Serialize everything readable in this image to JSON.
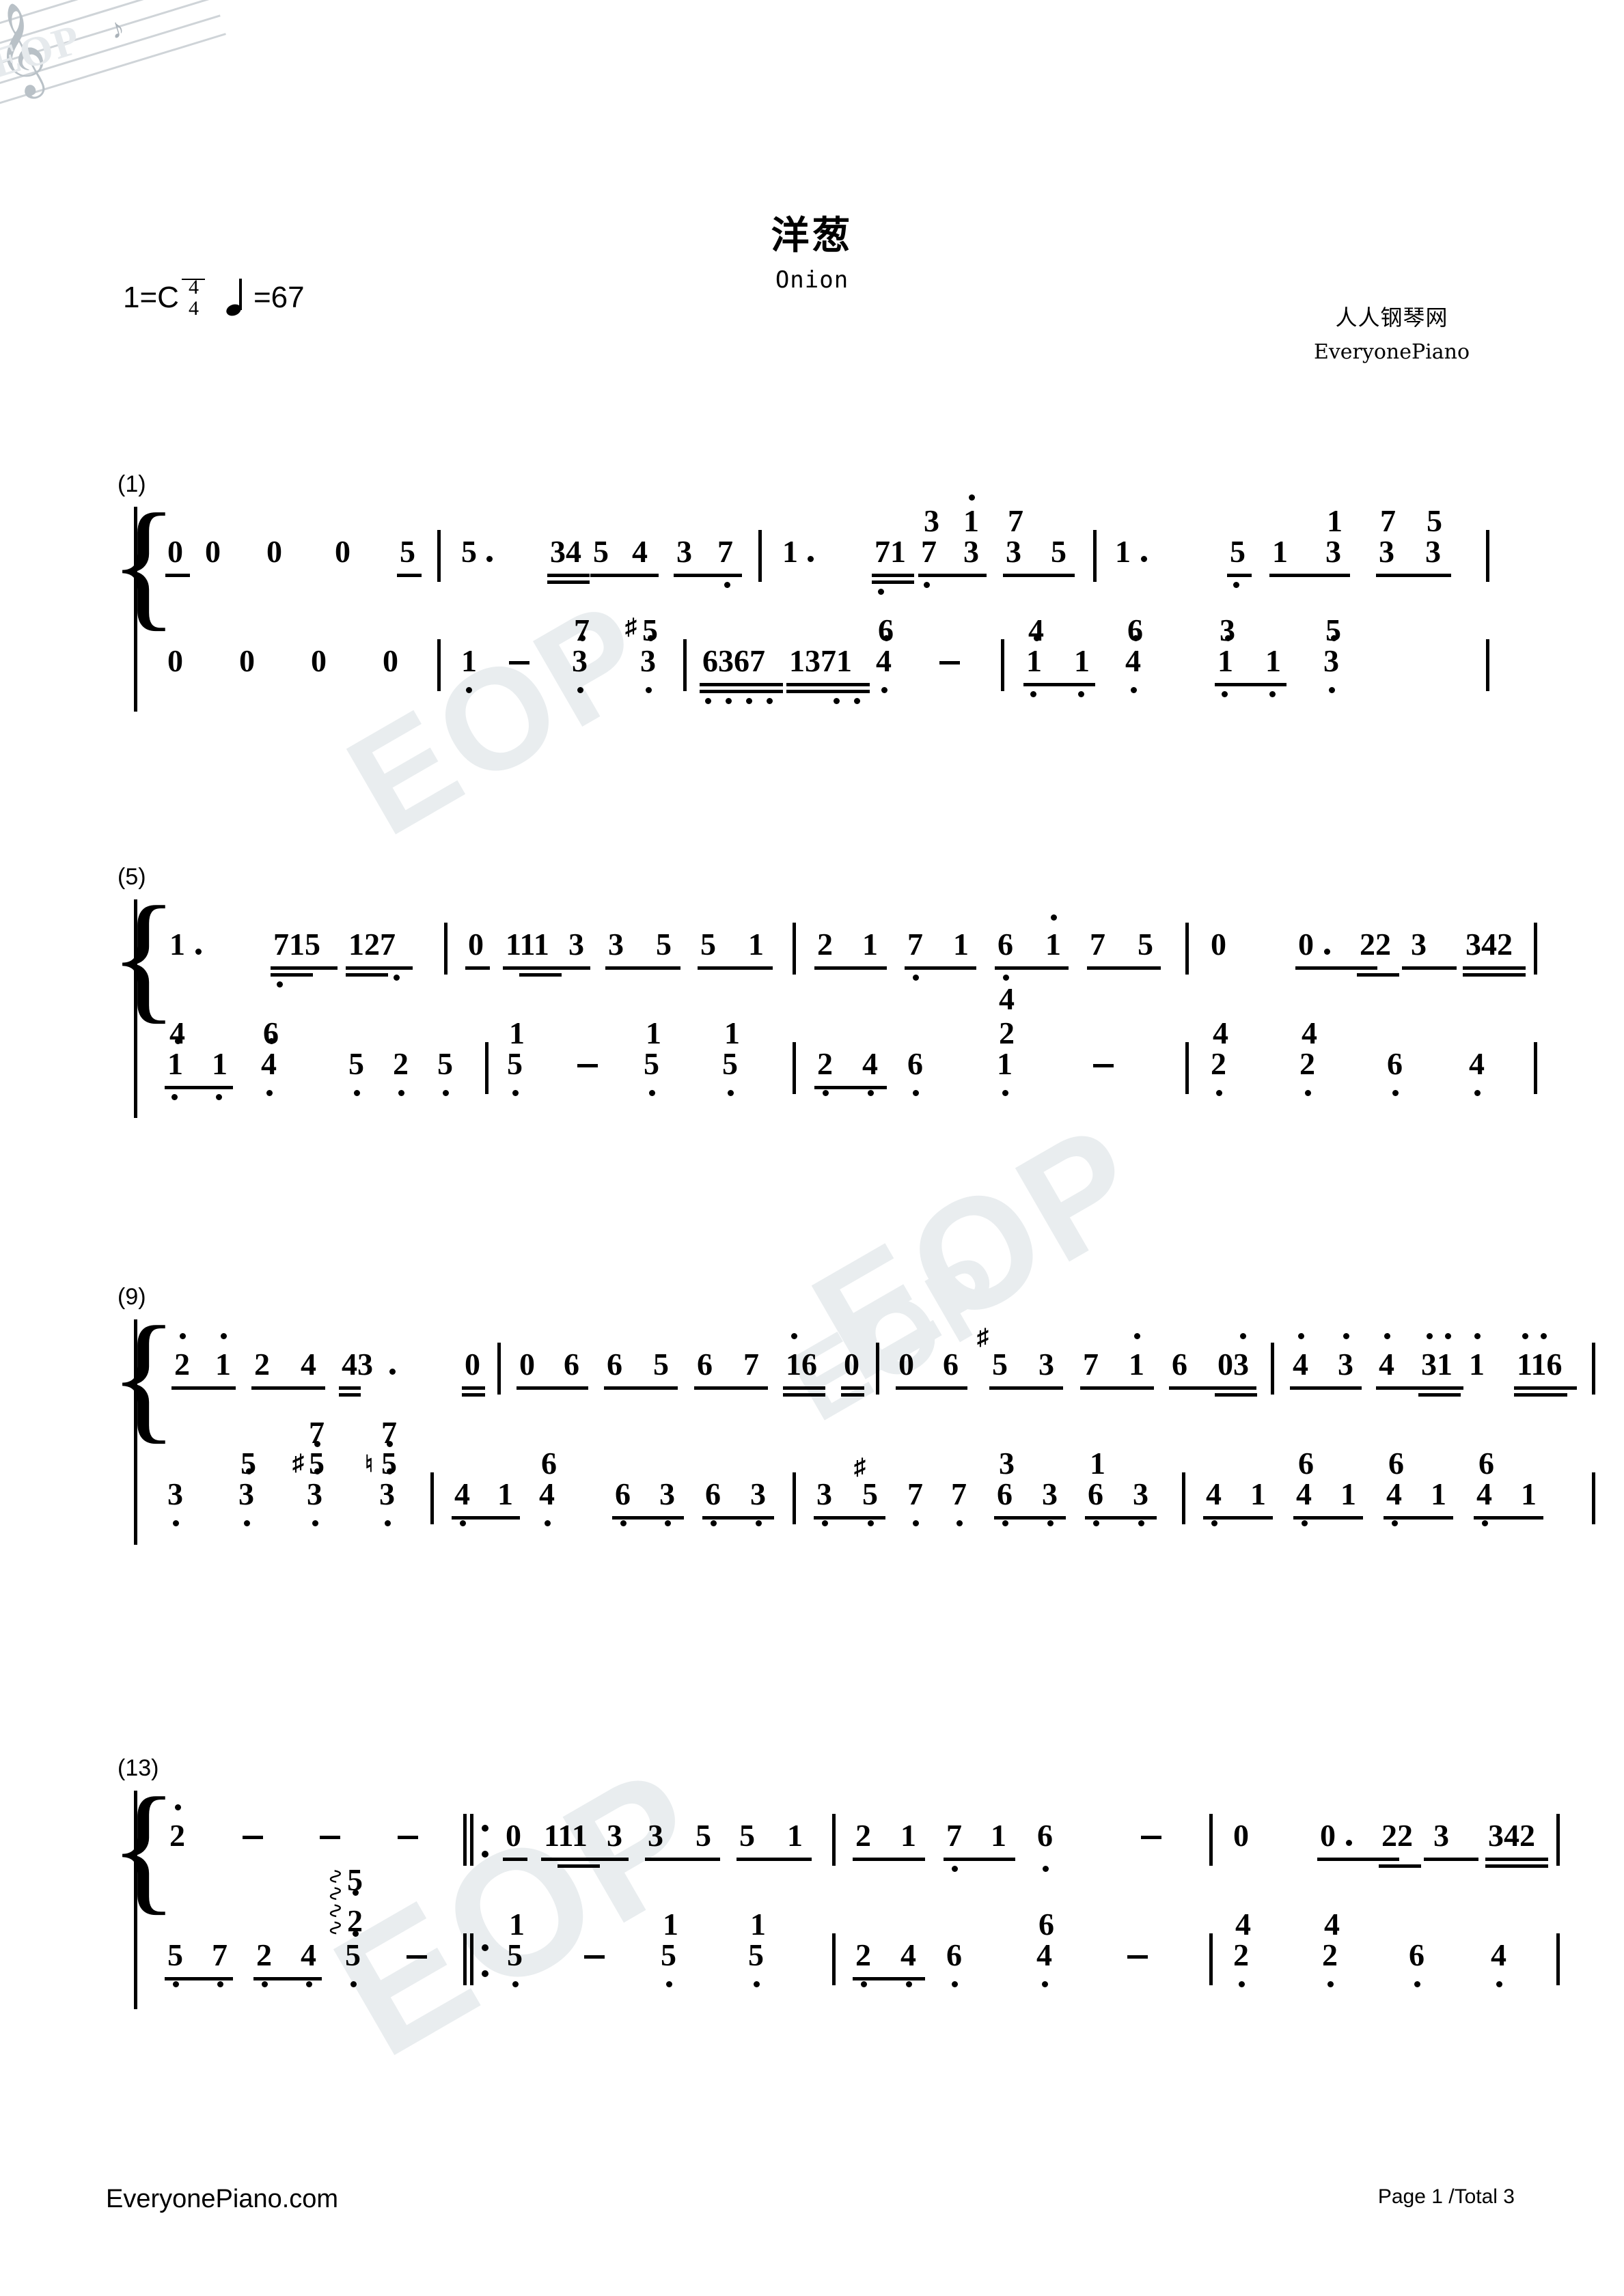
{
  "header": {
    "title_cn": "洋葱",
    "title_en": "Onion",
    "key_prefix": "1=C",
    "time_top": "4",
    "time_bottom": "4",
    "tempo": "=67",
    "credit_cn": "人人钢琴网",
    "credit_en": "EveryonePiano"
  },
  "footer": {
    "site": "EveryonePiano.com",
    "page": "Page 1 /Total 3"
  },
  "watermarks": [
    "EOP",
    "EOP",
    "EOP",
    "EOP"
  ],
  "logo": {
    "text": "EOP"
  },
  "systems": [
    {
      "label": "(1)"
    },
    {
      "label": "(5)"
    },
    {
      "label": "(9)"
    },
    {
      "label": "(13)"
    }
  ],
  "chart_data": {
    "type": "table",
    "title": "洋葱 Onion — Numbered musical notation (jianpu), piano grand staff",
    "key": "1=C",
    "time_signature": "4/4",
    "tempo_bpm": 67,
    "page": "1 of 3",
    "systems": [
      {
        "measure_label": "(1)",
        "treble": [
          "0 0  0  0  5 |",
          "5·  34 5 4 3 7 |",
          "1·  71 [3/7] [1/3] [7/3] 5 |",
          "1·  5 1 [1/3] [7/3] [5/3] |"
        ],
        "bass": [
          "0  0  0  0 |",
          "[1/1] -  [7/3] [#5/3] |",
          "6367 1371 [6/4] - |",
          "[4/1] 1 [6/4] [3/1] 1 [5/3] |"
        ]
      },
      {
        "measure_label": "(5)",
        "treble": [
          "1·  715 127 |",
          "0 111 3 3 5 5 1 |",
          "2 1 7 1 6 1 7 5 |",
          "0  0· 22 3 342 |"
        ],
        "bass": [
          "[4/1] 1 [6/4]  5 2 5 |",
          "[1/5] - [1/5] [1/5] |",
          "2 4 6 [4/2/1] - |",
          "[4/2] [4/2] 6 4 |"
        ]
      },
      {
        "measure_label": "(9)",
        "treble": [
          "2 1 2 4 43·  0 |",
          "0 6 6 5 6 7 16 0 |",
          "0 6 #5 3 7 1 6 03 |",
          "4 3 4 31 1  116 |"
        ],
        "bass": [
          "3 [5/3] [7/#5/3] [7/♮5/3] |",
          "[4/1] 4 [6/3] 6 3 |",
          "[3/#5] 7 7 [3/6] 3 [1/6] 3 |",
          "[6/4/1] [6/4/1] [6/4/1] [6/4/1] |"
        ]
      },
      {
        "measure_label": "(13)",
        "treble": [
          "2 - - -  ‖:",
          "0 111 3 3 5 5 1 |",
          "2 1 7 1 6  - |",
          "0  0· 22 3 342 |"
        ],
        "bass": [
          "5 7 2 4 [5/2/5] -  ‖:",
          "[1/5] - [1/5] [1/5] |",
          "2 4 6 [6/4] - |",
          "[4/2] [4/2] 6 4 |"
        ]
      }
    ]
  }
}
